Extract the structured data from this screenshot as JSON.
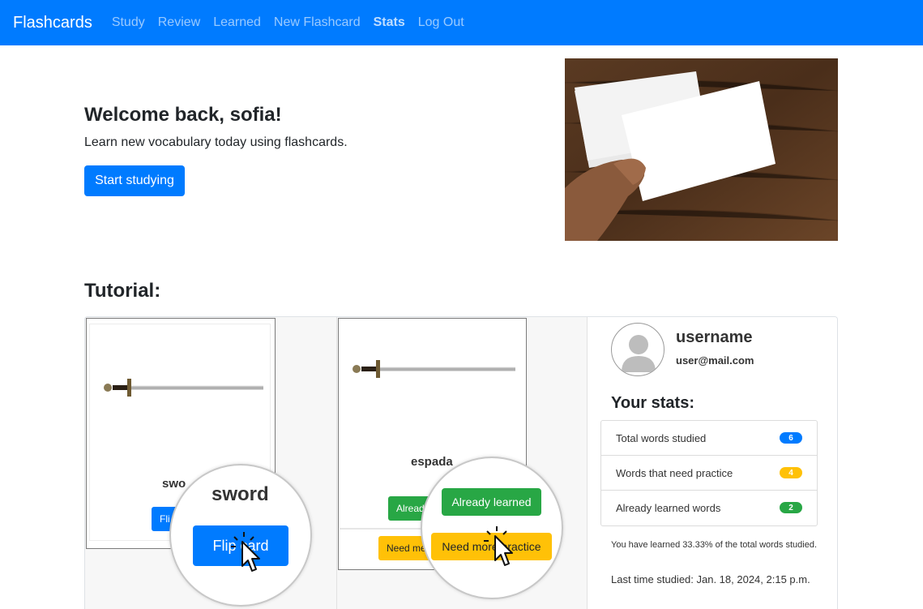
{
  "navbar": {
    "brand": "Flashcards",
    "links": [
      "Study",
      "Review",
      "Learned",
      "New Flashcard",
      "Stats",
      "Log Out"
    ],
    "active_link": "Stats",
    "background": "#007bff"
  },
  "hero": {
    "title": "Welcome back, sofia!",
    "subtitle": "Learn new vocabulary today using flashcards.",
    "button_label": "Start studying"
  },
  "tutorial": {
    "title": "Tutorial:",
    "step1": {
      "card_word_partial": "swo",
      "card_button_partial": "Fli",
      "zoom_word": "sword",
      "zoom_button": "Flip card"
    },
    "step2": {
      "card_word": "espada",
      "card_button1_partial": "Alread",
      "card_button2_partial": "Need me",
      "zoom_button1": "Already learned",
      "zoom_button2": "Need more practice"
    },
    "step3": {
      "username": "username",
      "email": "user@mail.com",
      "stats_title": "Your stats:",
      "stats": [
        {
          "label": "Total words studied",
          "value": "6",
          "color": "#007bff"
        },
        {
          "label": "Words that need practice",
          "value": "4",
          "color": "#ffc107"
        },
        {
          "label": "Already learned words",
          "value": "2",
          "color": "#28a745"
        }
      ],
      "learned_text": "You have learned 33.33% of the total words studied.",
      "last_studied": "Last time studied: Jan. 18, 2024, 2:15 p.m."
    }
  },
  "colors": {
    "primary": "#007bff",
    "warning": "#ffc107",
    "success": "#28a745"
  }
}
